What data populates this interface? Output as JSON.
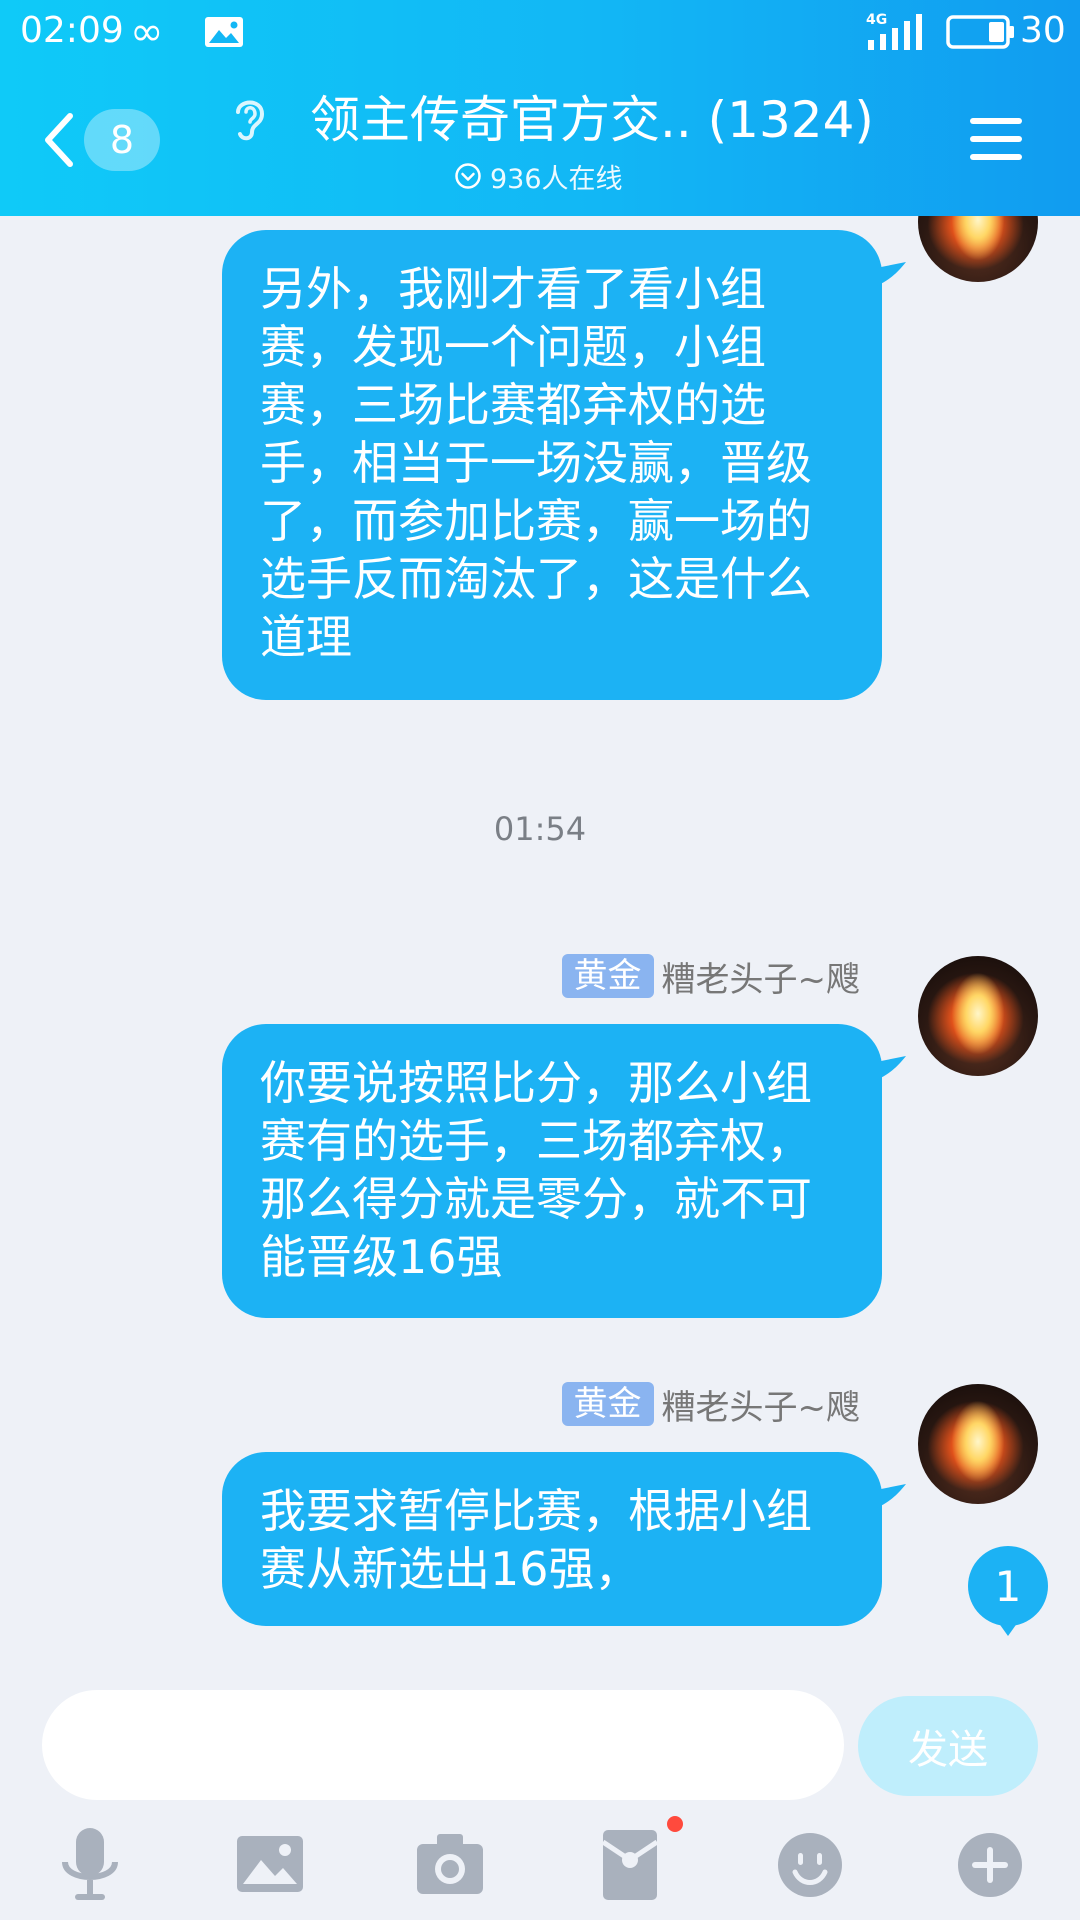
{
  "status_bar": {
    "time": "02:09",
    "network": "4G",
    "battery_level": "30"
  },
  "header": {
    "unread_count": "8",
    "title": "领主传奇官方交.. (1324)",
    "online_text": "936人在线"
  },
  "messages": [
    {
      "text": "另外，我刚才看了看小组赛，发现一个问题，小组赛，三场比赛都弃权的选手，相当于一场没赢，晋级了，而参加比赛，赢一场的选手反而淘汰了，这是什么道理"
    },
    {
      "rank": "黄金",
      "sender": "糟老头子~飕",
      "text": "你要说按照比分，那么小组赛有的选手，三场都弃权，那么得分就是零分，就不可能晋级16强"
    },
    {
      "rank": "黄金",
      "sender": "糟老头子~飕",
      "text": "我要求暂停比赛，根据小组赛从新选出16强，"
    }
  ],
  "timestamp": "01:54",
  "new_message_count": "1",
  "input": {
    "value": "",
    "send_label": "发送"
  },
  "colors": {
    "header_start": "#0fcaf8",
    "header_end": "#119cf0",
    "bubble": "#1cb2f4",
    "rank_badge": "#8ab4f0",
    "send_disabled": "#bfeefc",
    "notification_dot": "#ff4a3d"
  },
  "toolbar_icons": [
    "microphone-icon",
    "image-icon",
    "camera-icon",
    "red-packet-icon",
    "emoji-icon",
    "plus-icon"
  ]
}
